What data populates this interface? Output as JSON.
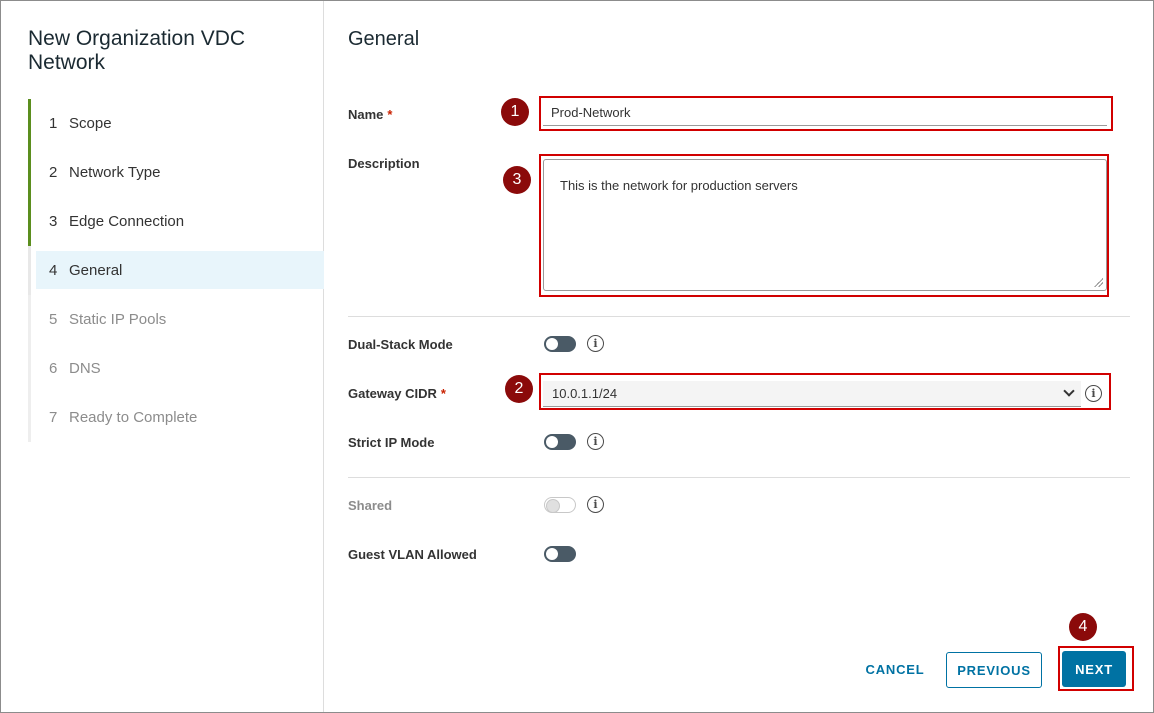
{
  "wizard": {
    "title": "New Organization VDC Network",
    "steps": [
      {
        "num": "1",
        "label": "Scope",
        "state": "done"
      },
      {
        "num": "2",
        "label": "Network Type",
        "state": "done"
      },
      {
        "num": "3",
        "label": "Edge Connection",
        "state": "done"
      },
      {
        "num": "4",
        "label": "General",
        "state": "active"
      },
      {
        "num": "5",
        "label": "Static IP Pools",
        "state": "todo"
      },
      {
        "num": "6",
        "label": "DNS",
        "state": "todo"
      },
      {
        "num": "7",
        "label": "Ready to Complete",
        "state": "todo"
      }
    ]
  },
  "form": {
    "section_title": "General",
    "name_label": "Name",
    "required_mark": "*",
    "name_value": "Prod-Network",
    "description_label": "Description",
    "description_value": "This is the network for production servers",
    "dual_stack_label": "Dual-Stack Mode",
    "dual_stack_on": false,
    "gateway_cidr_label": "Gateway CIDR",
    "gateway_cidr_value": "10.0.1.1/24",
    "strict_ip_label": "Strict IP Mode",
    "strict_ip_on": false,
    "shared_label": "Shared",
    "shared_on": false,
    "guest_vlan_label": "Guest VLAN Allowed",
    "guest_vlan_on": false,
    "info_glyph": "i"
  },
  "footer": {
    "cancel_label": "CANCEL",
    "previous_label": "PREVIOUS",
    "next_label": "NEXT"
  },
  "annotations": {
    "markers": [
      "1",
      "3",
      "2",
      "4"
    ],
    "highlight_color": "#d10000",
    "marker_color": "#8b0a0a"
  },
  "colors": {
    "accent": "#0072a3",
    "step_done": "#5b8e1e",
    "active_step_bg": "#e8f5fb",
    "required": "#c92100"
  }
}
